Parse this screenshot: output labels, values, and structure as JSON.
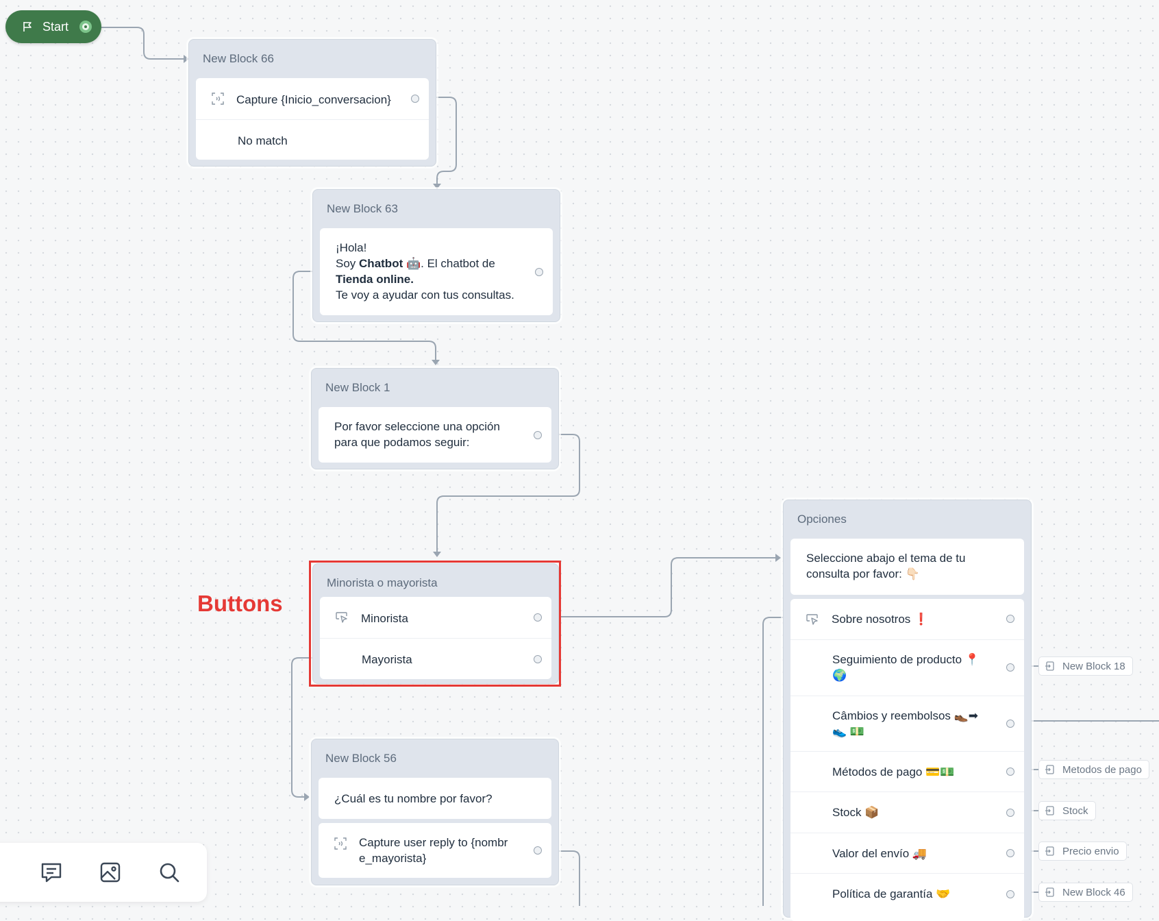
{
  "start": {
    "label": "Start"
  },
  "annotation": "Buttons",
  "blocks": {
    "b66": {
      "title": "New Block 66",
      "capture": "Capture {Inicio_conversacion}",
      "no_match": "No match"
    },
    "b63": {
      "title": "New Block 63",
      "line1": "¡Hola!",
      "line2_pre": "Soy ",
      "line2_bold": "Chatbot",
      "line2_post": " 🤖. El chatbot de",
      "line3_bold": "Tienda online.",
      "line4": "Te voy a ayudar con tus consultas."
    },
    "b1": {
      "title": "New Block 1",
      "line1": "Por favor seleccione una opción",
      "line2": "para que podamos seguir:"
    },
    "bmm": {
      "title": "Minorista o mayorista",
      "btn1": "Minorista",
      "btn2": "Mayorista"
    },
    "b56": {
      "title": "New Block 56",
      "question": "¿Cuál es tu nombre por favor?",
      "capture1": "Capture user reply to {nombr",
      "capture2": "e_mayorista}"
    },
    "opc": {
      "title": "Opciones",
      "msg1": "Seleccione abajo el tema de tu",
      "msg2": "consulta por favor: 👇🏻",
      "items": [
        {
          "label": "Sobre nosotros ❗"
        },
        {
          "label": "Seguimiento de producto 📍",
          "label2": "🌍"
        },
        {
          "label": "Câmbios y reembolsos 👞➡",
          "label2": "👟 💵"
        },
        {
          "label": "Métodos de pago 💳💵"
        },
        {
          "label": "Stock 📦"
        },
        {
          "label": "Valor del envío 🚚"
        },
        {
          "label": "Política de garantía 🤝"
        }
      ]
    }
  },
  "tags": [
    "New Block 18",
    "Metodos de pago",
    "Stock",
    "Precio envio",
    "New Block 46"
  ],
  "toolbar": [
    "block-icon",
    "message-icon",
    "image-icon",
    "search-icon"
  ]
}
